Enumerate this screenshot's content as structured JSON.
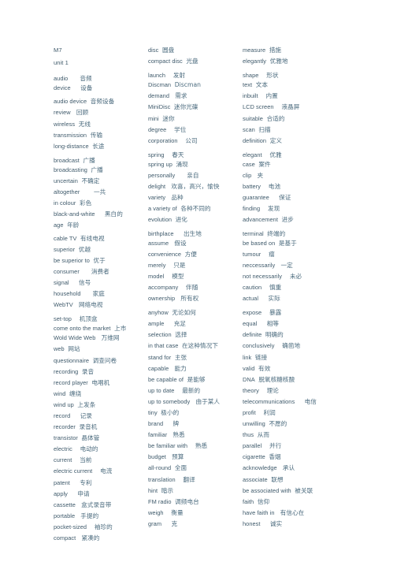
{
  "document": {
    "title": "M7",
    "subtitle": "unit 1",
    "text_color": "#3f5a6b",
    "background_color": "#ffffff",
    "columns": [
      {
        "name": "column-1",
        "entries": [
          {
            "term": "M7",
            "gloss": "",
            "gap_before": 0,
            "heading": true
          },
          {
            "term": "unit 1",
            "gloss": "",
            "gap_before": 4,
            "heading": true
          },
          {
            "term": "audio",
            "gloss": "音频",
            "gap_before": 8,
            "space": 5
          },
          {
            "term": "device",
            "gloss": "设备",
            "gap_before": 0,
            "space": 4
          },
          {
            "term": "audio device",
            "gloss": "音频设备",
            "gap_before": 5,
            "space": 1
          },
          {
            "term": "review",
            "gloss": "回顾",
            "gap_before": 2,
            "space": 2
          },
          {
            "term": "wireless",
            "gloss": "无线",
            "gap_before": 2,
            "space": 1
          },
          {
            "term": "transmission",
            "gloss": "传输",
            "gap_before": 2,
            "space": 1
          },
          {
            "term": "long-distance",
            "gloss": "长途",
            "gap_before": 2,
            "space": 1
          },
          {
            "term": "broadcast",
            "gloss": "广播",
            "gap_before": 6,
            "space": 0
          },
          {
            "term": "broadcasting",
            "gloss": "广播",
            "gap_before": 0,
            "space": 1
          },
          {
            "term": "uncertain",
            "gloss": "不确定",
            "gap_before": 2,
            "space": 0
          },
          {
            "term": "altogether",
            "gloss": "一共",
            "gap_before": 2,
            "space": 6
          },
          {
            "term": "in colour",
            "gloss": "彩色",
            "gap_before": 2,
            "space": 1
          },
          {
            "term": "black-and-white",
            "gloss": "黑白的",
            "gap_before": 2,
            "space": 4
          },
          {
            "term": "age",
            "gloss": "年龄",
            "gap_before": 2,
            "space": 1
          },
          {
            "term": "cable TV",
            "gloss": "有线电视",
            "gap_before": 4,
            "space": 1
          },
          {
            "term": "superior",
            "gloss": "优越",
            "gap_before": 2,
            "space": 1
          },
          {
            "term": "be superior to",
            "gloss": "优于",
            "gap_before": 2,
            "space": 0
          },
          {
            "term": "consumer",
            "gloss": "消费者",
            "gap_before": 2,
            "space": 5
          },
          {
            "term": "signal",
            "gloss": "信号",
            "gap_before": 2,
            "space": 4
          },
          {
            "term": "household",
            "gloss": "家庭",
            "gap_before": 2,
            "space": 5
          },
          {
            "term": "WebTV",
            "gloss": "网络电视",
            "gap_before": 2,
            "space": 2
          },
          {
            "term": "set-top",
            "gloss": "机顶盒",
            "gap_before": 6,
            "space": 3
          },
          {
            "term": "come onto the market",
            "gloss": "上市",
            "gap_before": 0,
            "space": 0
          },
          {
            "term": "Wold Wide Web",
            "gloss": "万维网",
            "gap_before": 0,
            "space": 2
          },
          {
            "term": "web",
            "gloss": "网站",
            "gap_before": 2,
            "space": 1
          },
          {
            "term": "questionnaire",
            "gloss": "调查问卷",
            "gap_before": 2,
            "space": 1
          },
          {
            "term": "recording",
            "gloss": "录音",
            "gap_before": 2,
            "space": 1
          },
          {
            "term": "record player",
            "gloss": "电唱机",
            "gap_before": 2,
            "space": 1
          },
          {
            "term": "wind",
            "gloss": "缠绕",
            "gap_before": 2,
            "space": 0
          },
          {
            "term": "wind up",
            "gloss": "上发条",
            "gap_before": 2,
            "space": 1
          },
          {
            "term": "record",
            "gloss": "记录",
            "gap_before": 2,
            "space": 4
          },
          {
            "term": "recorder",
            "gloss": "录音机",
            "gap_before": 2,
            "space": 1
          },
          {
            "term": "transistor",
            "gloss": "晶体管",
            "gap_before": 2,
            "space": 0
          },
          {
            "term": "electric",
            "gloss": "电动的",
            "gap_before": 2,
            "space": 3
          },
          {
            "term": "current",
            "gloss": "当前",
            "gap_before": 2,
            "space": 3
          },
          {
            "term": "electric current",
            "gloss": "电流",
            "gap_before": 2,
            "space": 3
          },
          {
            "term": "patent",
            "gloss": "专利",
            "gap_before": 2,
            "space": 4
          },
          {
            "term": "apply",
            "gloss": "申请",
            "gap_before": 2,
            "space": 4
          },
          {
            "term": "cassette",
            "gloss": "盒式录音带",
            "gap_before": 2,
            "space": 2
          },
          {
            "term": "portable",
            "gloss": "手提的",
            "gap_before": 2,
            "space": 2
          },
          {
            "term": "pocket-sized",
            "gloss": "袖珍的",
            "gap_before": 2,
            "space": 3
          },
          {
            "term": "compact",
            "gloss": "紧凑的",
            "gap_before": 2,
            "space": 2
          }
        ]
      },
      {
        "name": "column-2",
        "entries": [
          {
            "term": "disc",
            "gloss": "圆盘",
            "gap_before": 0,
            "space": 1
          },
          {
            "term": "compact disc",
            "gloss": "光盘",
            "gap_before": 2,
            "space": 1
          },
          {
            "term": "launch",
            "gloss": "发射",
            "gap_before": 6,
            "space": 3
          },
          {
            "term": "Discman",
            "gloss": "Discman",
            "gap_before": 0,
            "space": 1
          },
          {
            "term": "demand",
            "gloss": "需求",
            "gap_before": 2,
            "space": 2
          },
          {
            "term": "MiniDisc",
            "gloss": "迷你光碟",
            "gap_before": 2,
            "space": 1
          },
          {
            "term": "mini",
            "gloss": "迷你",
            "gap_before": 2,
            "space": 1
          },
          {
            "term": "degree",
            "gloss": "学位",
            "gap_before": 2,
            "space": 3
          },
          {
            "term": "corporation",
            "gloss": "公司",
            "gap_before": 2,
            "space": 3
          },
          {
            "term": "spring",
            "gloss": "春天",
            "gap_before": 6,
            "space": 3
          },
          {
            "term": "spring up",
            "gloss": "涌现",
            "gap_before": 0,
            "space": 0
          },
          {
            "term": "personally",
            "gloss": "亲自",
            "gap_before": 2,
            "space": 5
          },
          {
            "term": "delight",
            "gloss": "欢喜，高兴，愉快",
            "gap_before": 2,
            "space": 2
          },
          {
            "term": "variety",
            "gloss": "品种",
            "gap_before": 2,
            "space": 2
          },
          {
            "term": "a variety of",
            "gloss": "各种不同的",
            "gap_before": 2,
            "space": 1
          },
          {
            "term": "evolution",
            "gloss": "进化",
            "gap_before": 2,
            "space": 0
          },
          {
            "term": "birthplace",
            "gloss": "出生地",
            "gap_before": 5,
            "space": 4
          },
          {
            "term": "assume",
            "gloss": "假设",
            "gap_before": 0,
            "space": 2
          },
          {
            "term": "convenience",
            "gloss": "方便",
            "gap_before": 2,
            "space": 1
          },
          {
            "term": "merely",
            "gloss": "只是",
            "gap_before": 2,
            "space": 3
          },
          {
            "term": "model",
            "gloss": "模型",
            "gap_before": 2,
            "space": 3
          },
          {
            "term": "accompany",
            "gloss": "伴随",
            "gap_before": 2,
            "space": 3
          },
          {
            "term": "ownership",
            "gloss": "所有权",
            "gap_before": 2,
            "space": 2
          },
          {
            "term": "anyhow",
            "gloss": "无论如何",
            "gap_before": 6,
            "space": 1
          },
          {
            "term": "ample",
            "gloss": "充足",
            "gap_before": 2,
            "space": 4
          },
          {
            "term": "selection",
            "gloss": "选择",
            "gap_before": 2,
            "space": 1
          },
          {
            "term": "in that case",
            "gloss": "在这种情况下",
            "gap_before": 2,
            "space": 0
          },
          {
            "term": "stand for",
            "gloss": "主张",
            "gap_before": 2,
            "space": 0
          },
          {
            "term": "capable",
            "gloss": "能力",
            "gap_before": 2,
            "space": 2
          },
          {
            "term": "be capable of",
            "gloss": "是能够",
            "gap_before": 2,
            "space": 0
          },
          {
            "term": "up to date",
            "gloss": "最新的",
            "gap_before": 2,
            "space": 3
          },
          {
            "term": "up to somebody",
            "gloss": "由于某人",
            "gap_before": 2,
            "space": 2
          },
          {
            "term": "tiny",
            "gloss": "极小的",
            "gap_before": 2,
            "space": 1
          },
          {
            "term": "brand",
            "gloss": "牌",
            "gap_before": 2,
            "space": 4
          },
          {
            "term": "familiar",
            "gloss": "熟悉",
            "gap_before": 2,
            "space": 2
          },
          {
            "term": "be familiar with",
            "gloss": "熟悉",
            "gap_before": 2,
            "space": 3
          },
          {
            "term": "budget",
            "gloss": "预算",
            "gap_before": 2,
            "space": 2
          },
          {
            "term": "all-round",
            "gloss": "全面",
            "gap_before": 2,
            "space": 1
          },
          {
            "term": "translation",
            "gloss": "翻译",
            "gap_before": 2,
            "space": 3
          },
          {
            "term": "hint",
            "gloss": "暗示",
            "gap_before": 2,
            "space": 1
          },
          {
            "term": "FM radio",
            "gloss": "调频电台",
            "gap_before": 2,
            "space": 1
          },
          {
            "term": "weigh",
            "gloss": "衡量",
            "gap_before": 2,
            "space": 3
          },
          {
            "term": "gram",
            "gloss": "克",
            "gap_before": 2,
            "space": 4
          }
        ]
      },
      {
        "name": "column-3",
        "entries": [
          {
            "term": "measure",
            "gloss": "措施",
            "gap_before": 0,
            "space": 1
          },
          {
            "term": "elegantly",
            "gloss": "优雅地",
            "gap_before": 2,
            "space": 0
          },
          {
            "term": "shape",
            "gloss": "形状",
            "gap_before": 6,
            "space": 3
          },
          {
            "term": "text",
            "gloss": "文本",
            "gap_before": 0,
            "space": 1
          },
          {
            "term": "inbuilt",
            "gloss": "内置",
            "gap_before": 2,
            "space": 3
          },
          {
            "term": "LCD screen",
            "gloss": "液晶屏",
            "gap_before": 2,
            "space": 3
          },
          {
            "term": "suitable",
            "gloss": "合适的",
            "gap_before": 2,
            "space": 1
          },
          {
            "term": "scan",
            "gloss": "扫描",
            "gap_before": 2,
            "space": 0
          },
          {
            "term": "definition",
            "gloss": "定义",
            "gap_before": 2,
            "space": 0
          },
          {
            "term": "elegant",
            "gloss": "优雅",
            "gap_before": 6,
            "space": 3
          },
          {
            "term": "case",
            "gloss": "案件",
            "gap_before": 0,
            "space": 1
          },
          {
            "term": "clip",
            "gloss": "夹",
            "gap_before": 2,
            "space": 2
          },
          {
            "term": "battery",
            "gloss": "电池",
            "gap_before": 2,
            "space": 3
          },
          {
            "term": "guarantee",
            "gloss": "保证",
            "gap_before": 2,
            "space": 4
          },
          {
            "term": "finding",
            "gloss": "发现",
            "gap_before": 2,
            "space": 3
          },
          {
            "term": "advancement",
            "gloss": "进步",
            "gap_before": 2,
            "space": 1
          },
          {
            "term": "terminal",
            "gloss": "终端的",
            "gap_before": 5,
            "space": 1
          },
          {
            "term": "be based on",
            "gloss": "是基于",
            "gap_before": 0,
            "space": 1
          },
          {
            "term": "tumour",
            "gloss": "瘤",
            "gap_before": 2,
            "space": 3
          },
          {
            "term": "neccessarily",
            "gloss": "一定",
            "gap_before": 2,
            "space": 2
          },
          {
            "term": "not necessarily",
            "gloss": "未必",
            "gap_before": 2,
            "space": 3
          },
          {
            "term": "caution",
            "gloss": "慎重",
            "gap_before": 2,
            "space": 3
          },
          {
            "term": "actual",
            "gloss": "实际",
            "gap_before": 2,
            "space": 4
          },
          {
            "term": "expose",
            "gloss": "暴露",
            "gap_before": 6,
            "space": 3
          },
          {
            "term": "equal",
            "gloss": "相等",
            "gap_before": 2,
            "space": 4
          },
          {
            "term": "definite",
            "gloss": "明确的",
            "gap_before": 2,
            "space": 1
          },
          {
            "term": "conclusively",
            "gloss": "确凿地",
            "gap_before": 2,
            "space": 3
          },
          {
            "term": "link",
            "gloss": "链接",
            "gap_before": 2,
            "space": 1
          },
          {
            "term": "valid",
            "gloss": "有效",
            "gap_before": 2,
            "space": 0
          },
          {
            "term": "DNA",
            "gloss": "脱氧核糖核酸",
            "gap_before": 2,
            "space": 0
          },
          {
            "term": "theory",
            "gloss": "理论",
            "gap_before": 2,
            "space": 3
          },
          {
            "term": "telecommunications",
            "gloss": "电信",
            "gap_before": 2,
            "space": 4
          },
          {
            "term": "profit",
            "gloss": "利润",
            "gap_before": 2,
            "space": 3
          },
          {
            "term": "unwilling",
            "gloss": "不愿的",
            "gap_before": 2,
            "space": 1
          },
          {
            "term": "thus",
            "gloss": "从而",
            "gap_before": 2,
            "space": 0
          },
          {
            "term": "parallel",
            "gloss": "并行",
            "gap_before": 2,
            "space": 3
          },
          {
            "term": "cigarette",
            "gloss": "香烟",
            "gap_before": 2,
            "space": 1
          },
          {
            "term": "acknowledge",
            "gloss": "承认",
            "gap_before": 2,
            "space": 2
          },
          {
            "term": "associate",
            "gloss": "联想",
            "gap_before": 2,
            "space": 1
          },
          {
            "term": "be associated with",
            "gloss": "被关联",
            "gap_before": 2,
            "space": 0
          },
          {
            "term": "faith",
            "gloss": "信仰",
            "gap_before": 2,
            "space": 0
          },
          {
            "term": "have faith in",
            "gloss": "有信心在",
            "gap_before": 2,
            "space": 2
          },
          {
            "term": "honest",
            "gloss": "诚实",
            "gap_before": 2,
            "space": 4
          }
        ]
      }
    ]
  }
}
